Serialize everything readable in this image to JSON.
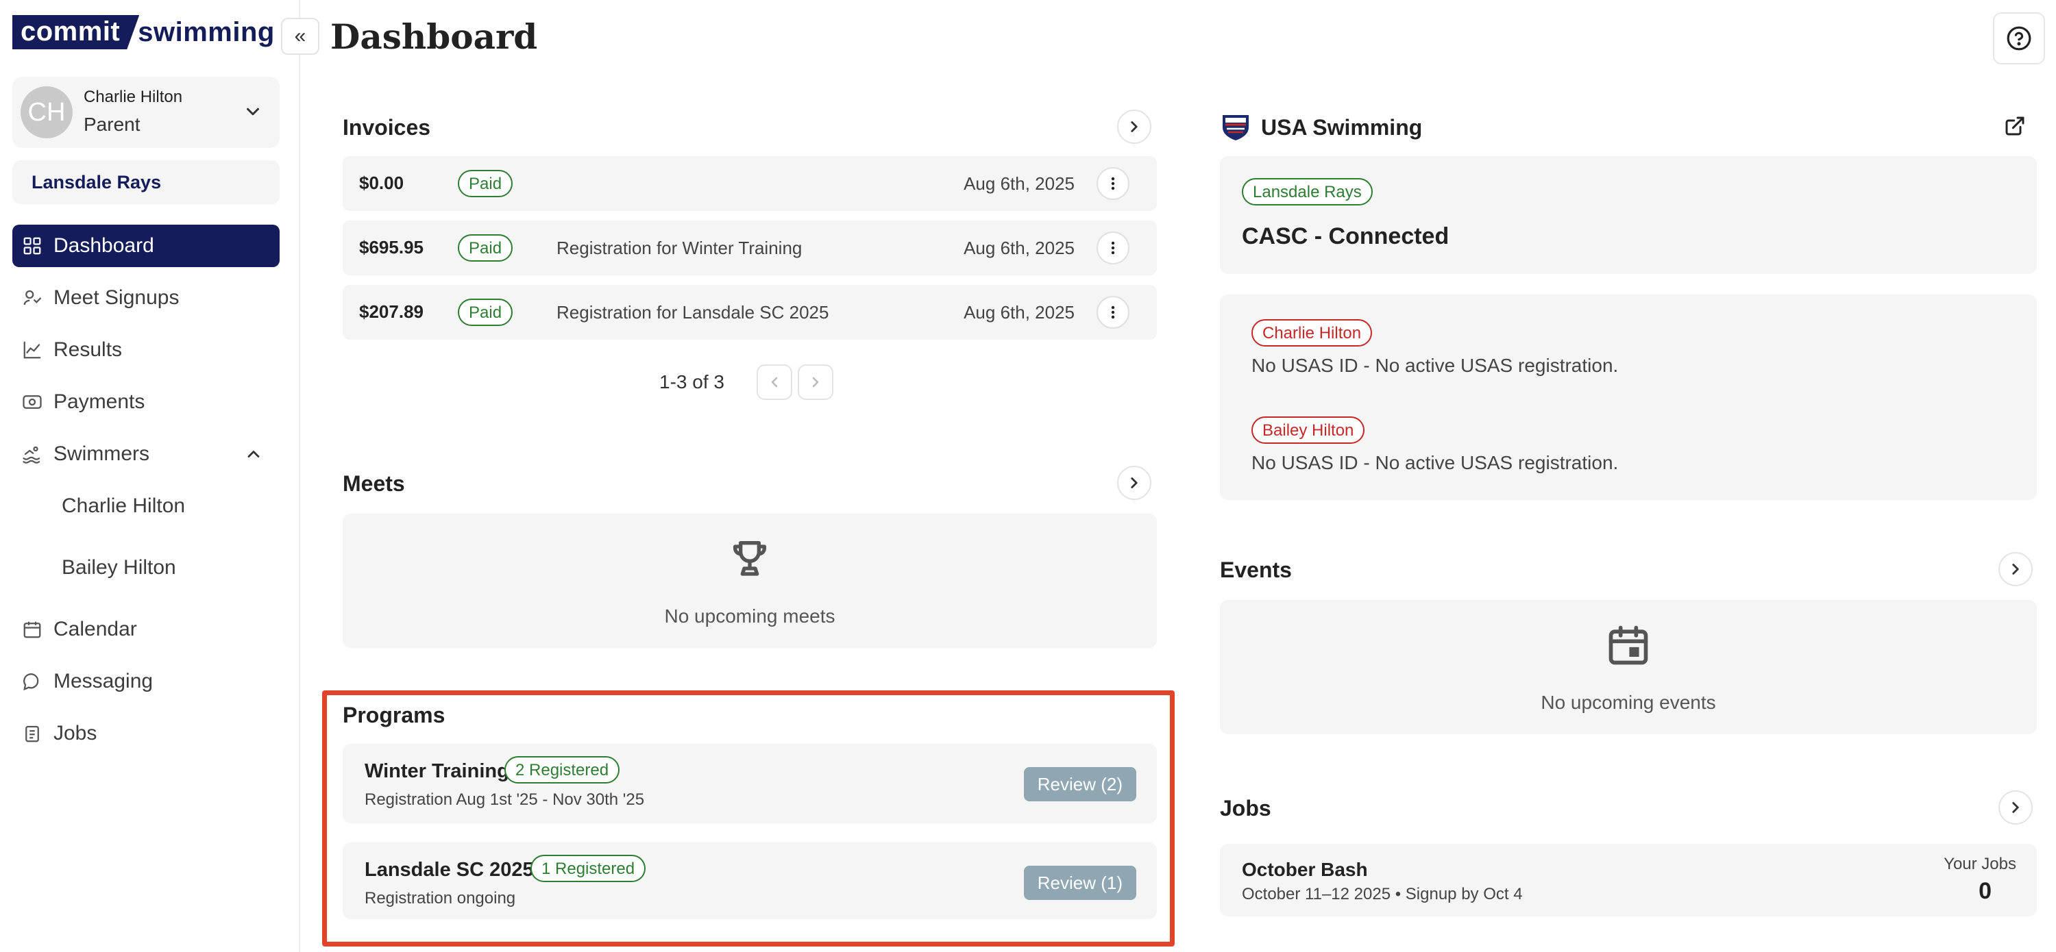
{
  "app": {
    "logo_box": "commit",
    "logo_text": "swimming",
    "page_title": "Dashboard"
  },
  "user": {
    "initials": "CH",
    "name": "Charlie Hilton",
    "role": "Parent",
    "team": "Lansdale Rays"
  },
  "nav": {
    "dashboard": "Dashboard",
    "meet_signups": "Meet Signups",
    "results": "Results",
    "payments": "Payments",
    "swimmers": "Swimmers",
    "swimmer_1": "Charlie Hilton",
    "swimmer_2": "Bailey Hilton",
    "calendar": "Calendar",
    "messaging": "Messaging",
    "jobs": "Jobs"
  },
  "invoices": {
    "title": "Invoices",
    "rows": [
      {
        "amount": "$0.00",
        "status": "Paid",
        "description": "",
        "date": "Aug 6th, 2025"
      },
      {
        "amount": "$695.95",
        "status": "Paid",
        "description": "Registration for Winter Training",
        "date": "Aug 6th, 2025"
      },
      {
        "amount": "$207.89",
        "status": "Paid",
        "description": "Registration for Lansdale SC 2025",
        "date": "Aug 6th, 2025"
      }
    ],
    "pagination": "1-3 of 3"
  },
  "meets": {
    "title": "Meets",
    "empty_text": "No upcoming meets"
  },
  "programs": {
    "title": "Programs",
    "rows": [
      {
        "name": "Winter Training",
        "badge": "2 Registered",
        "subtitle": "Registration Aug 1st '25 - Nov 30th '25",
        "action": "Review (2)"
      },
      {
        "name": "Lansdale SC 2025",
        "badge": "1 Registered",
        "subtitle": "Registration ongoing",
        "action": "Review (1)"
      }
    ]
  },
  "usa_swimming": {
    "title": "USA Swimming",
    "team_badge": "Lansdale Rays",
    "connection": "CASC - Connected",
    "swimmers": [
      {
        "name": "Charlie Hilton",
        "status": "No USAS ID - No active USAS registration."
      },
      {
        "name": "Bailey Hilton",
        "status": "No USAS ID - No active USAS registration."
      }
    ]
  },
  "events": {
    "title": "Events",
    "empty_text": "No upcoming events"
  },
  "jobs": {
    "title": "Jobs",
    "item_name": "October Bash",
    "item_subtitle": "October 11–12 2025 • Signup by Oct 4",
    "your_jobs_label": "Your Jobs",
    "your_jobs_count": "0"
  },
  "colors": {
    "brand_navy": "#141c5a",
    "paid_green": "#2e7d32",
    "alert_red": "#c62828",
    "highlight_orange": "#e0442c",
    "review_button": "#8fa6b3"
  },
  "icons": {
    "collapse": "double-chevron-left-icon",
    "help": "help-circle-icon",
    "meets_empty": "trophy-icon",
    "events_empty": "calendar-icon",
    "external": "external-link-icon"
  }
}
